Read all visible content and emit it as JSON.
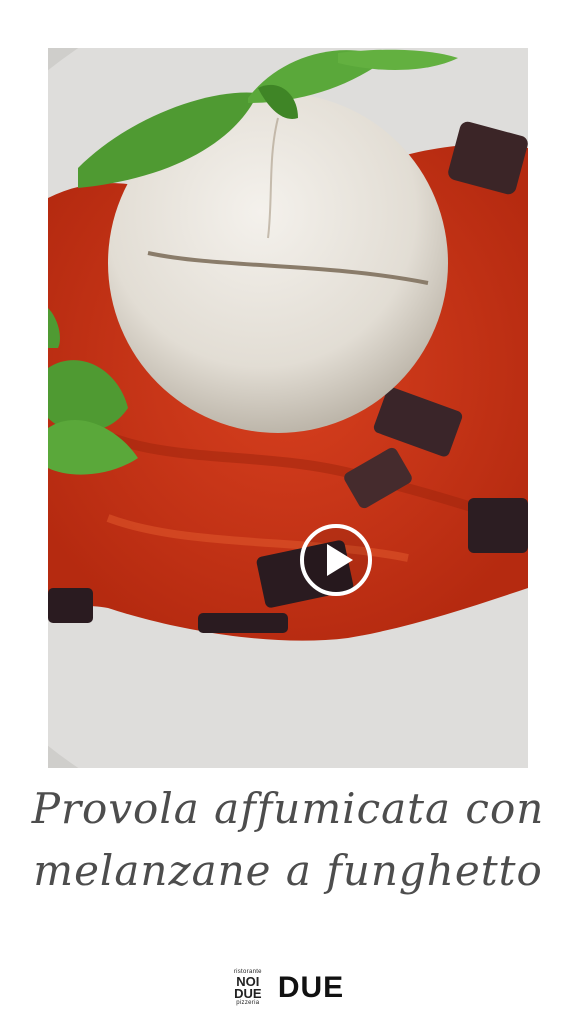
{
  "video": {
    "play_icon": "play-icon",
    "scene": "burrata-on-tomato-eggplant-plate"
  },
  "caption": {
    "line1": "Provola affumicata con",
    "line2": "melanzane a funghetto"
  },
  "brand": {
    "logo_top": "ristorante",
    "logo_main_1": "NOI",
    "logo_main_2": "DUE",
    "logo_bottom": "pizzeria",
    "name": "DUE"
  },
  "colors": {
    "sauce": "#c8361a",
    "plate": "#d9d9d6",
    "cheese": "#ece8e1",
    "basil": "#4f9a32"
  }
}
